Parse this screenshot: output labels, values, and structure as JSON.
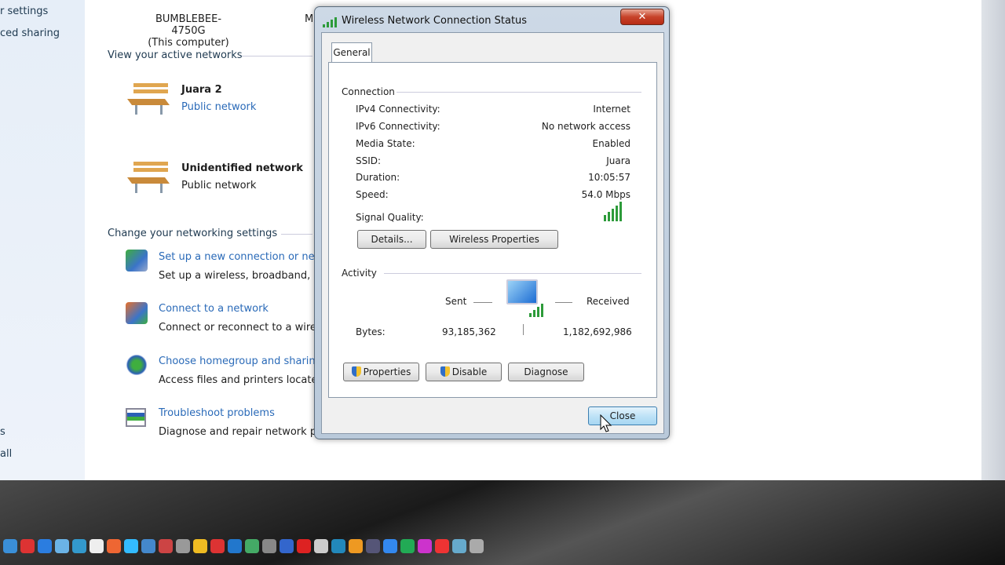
{
  "sidebar": {
    "items": [
      "r settings",
      "ced sharing",
      "s",
      "all"
    ]
  },
  "main": {
    "computer_name": "BUMBLEBEE-4750G",
    "computer_sub": "(This computer)",
    "partial_next": "M",
    "active_header": "View your active networks",
    "networks": [
      {
        "name": "Juara  2",
        "type": "Public network"
      },
      {
        "name": "Unidentified network",
        "type": "Public network"
      }
    ],
    "settings_header": "Change your networking settings",
    "tasks": [
      {
        "title": "Set up a new connection or net",
        "desc": "Set up a wireless, broadband, d"
      },
      {
        "title": "Connect to a network",
        "desc": "Connect or reconnect to a wire"
      },
      {
        "title": "Choose homegroup and sharin",
        "desc": "Access files and printers locate"
      },
      {
        "title": "Troubleshoot problems",
        "desc": "Diagnose and repair network pr"
      }
    ]
  },
  "dialog": {
    "title": "Wireless Network Connection Status",
    "close_glyph": "✕",
    "tab": "General",
    "connection_header": "Connection",
    "rows": [
      {
        "label": "IPv4 Connectivity:",
        "value": "Internet"
      },
      {
        "label": "IPv6 Connectivity:",
        "value": "No network access"
      },
      {
        "label": "Media State:",
        "value": "Enabled"
      },
      {
        "label": "SSID:",
        "value": "Juara"
      },
      {
        "label": "Duration:",
        "value": "10:05:57"
      },
      {
        "label": "Speed:",
        "value": "54.0 Mbps"
      }
    ],
    "signal_label": "Signal Quality:",
    "signal_bars": 5,
    "details_btn": "Details...",
    "wireless_props_btn": "Wireless Properties",
    "activity_header": "Activity",
    "sent_label": "Sent",
    "received_label": "Received",
    "bytes_label": "Bytes:",
    "bytes_sent": "93,185,362",
    "bytes_received": "1,182,692,986",
    "properties_btn": "Properties",
    "disable_btn": "Disable",
    "diagnose_btn": "Diagnose",
    "close_btn": "Close"
  }
}
